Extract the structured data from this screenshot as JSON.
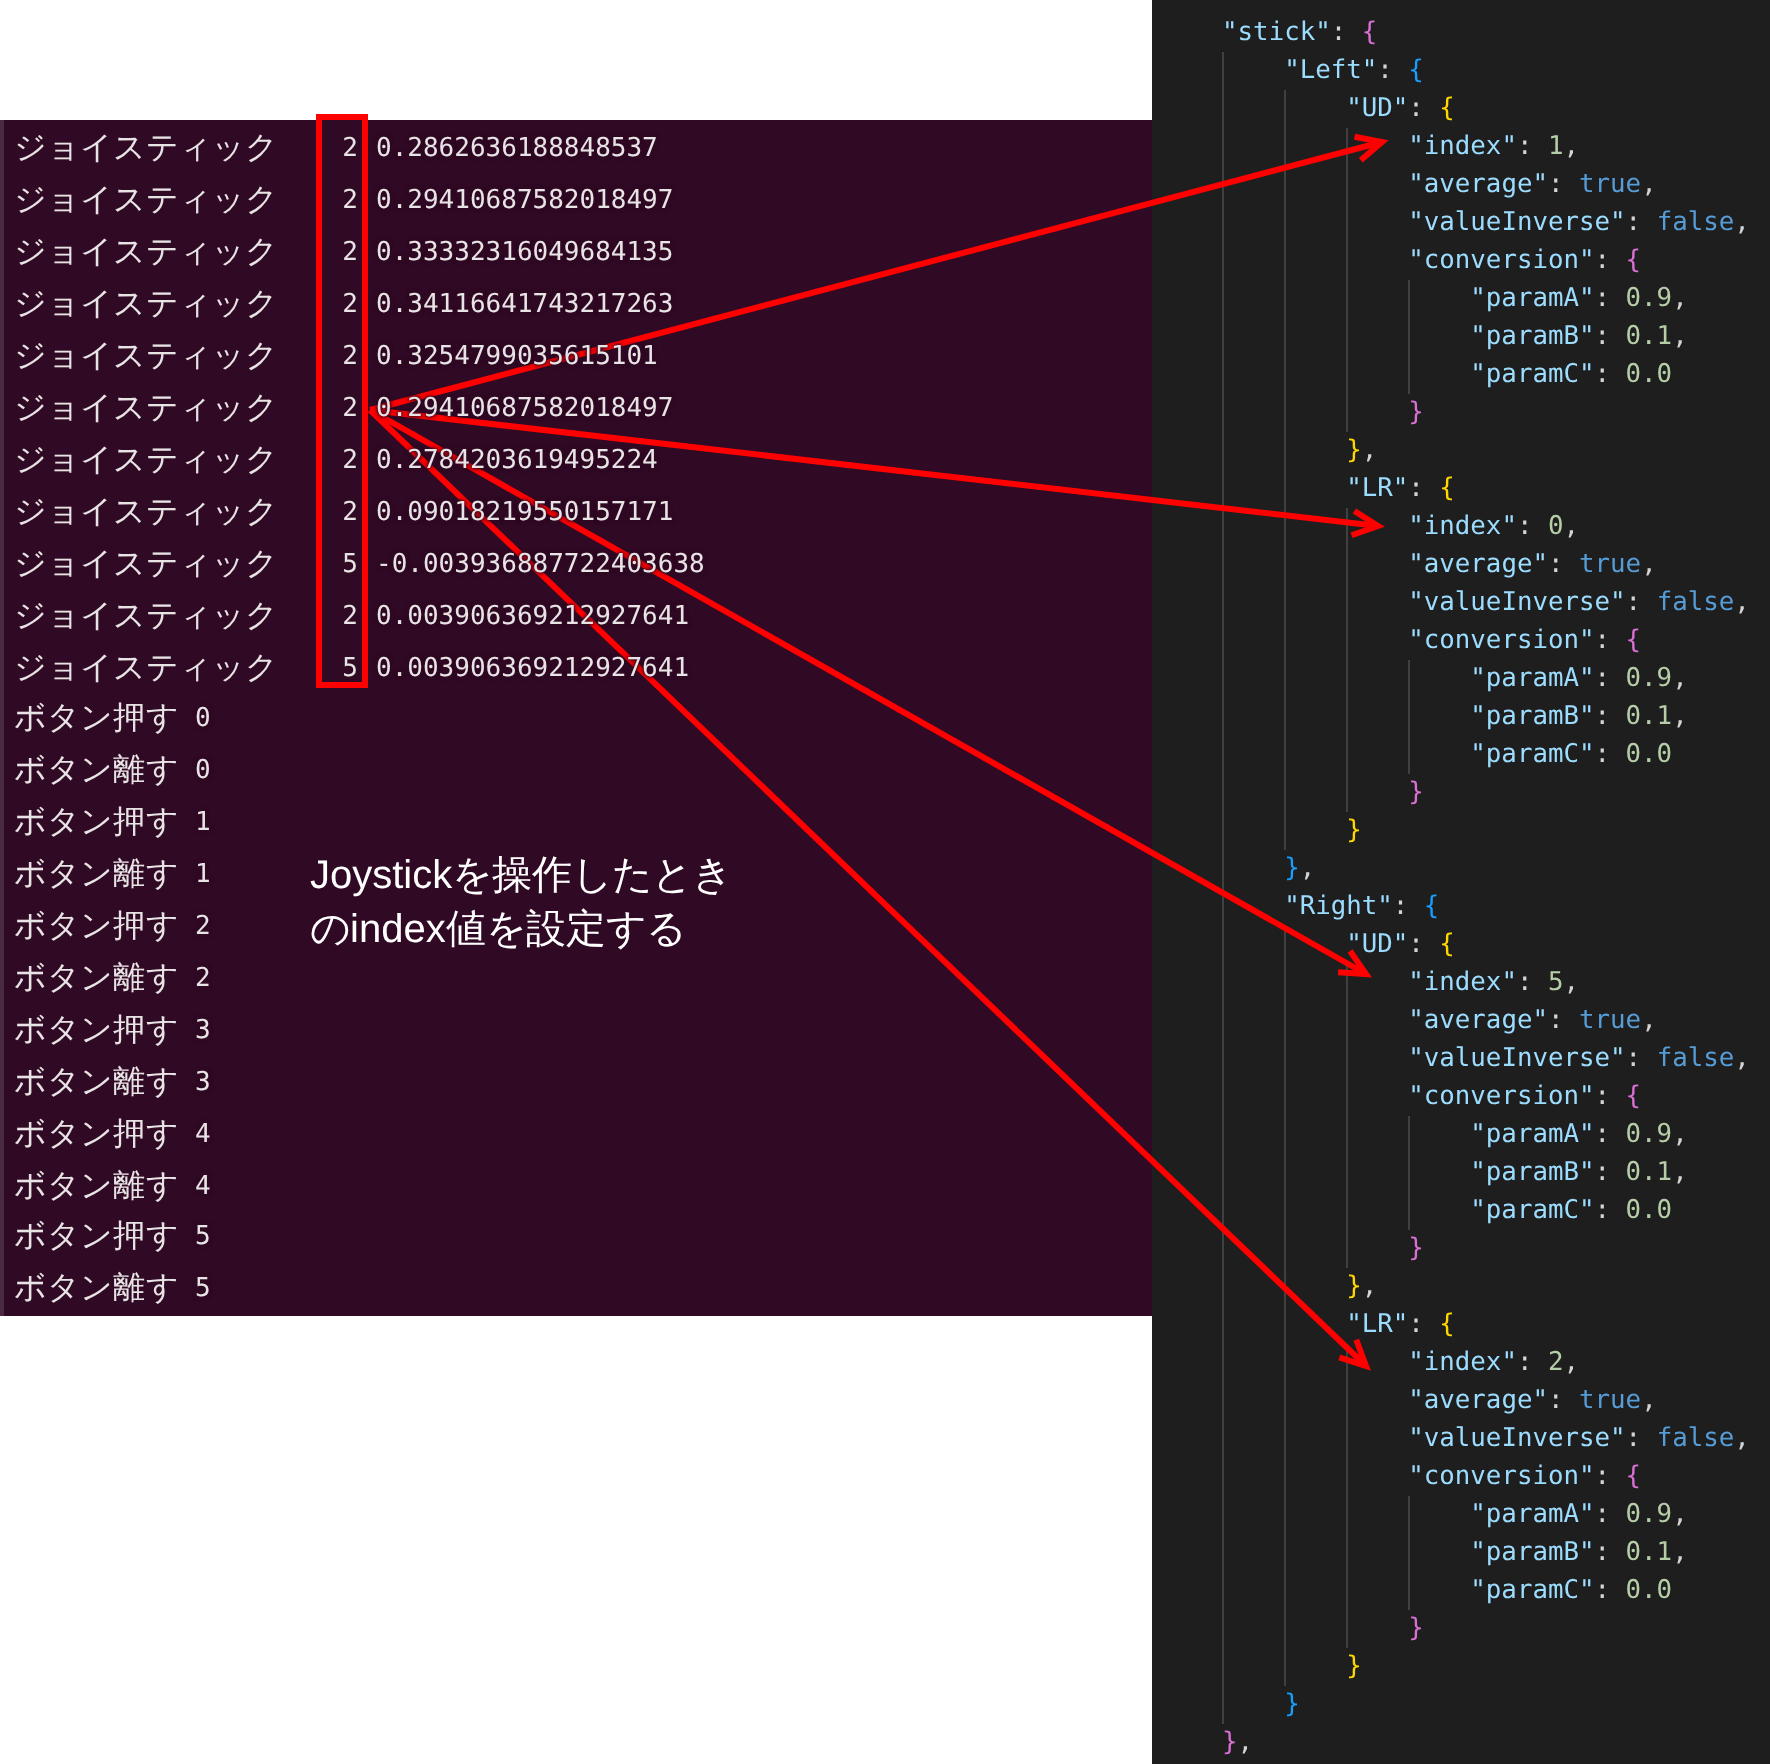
{
  "terminal": {
    "joystick_lines": [
      {
        "label": "ジョイスティック",
        "index": "2",
        "value": "0.2862636188848537"
      },
      {
        "label": "ジョイスティック",
        "index": "2",
        "value": "0.29410687582018497"
      },
      {
        "label": "ジョイスティック",
        "index": "2",
        "value": "0.33332316049684135"
      },
      {
        "label": "ジョイスティック",
        "index": "2",
        "value": "0.34116641743217263"
      },
      {
        "label": "ジョイスティック",
        "index": "2",
        "value": "0.3254799035615101"
      },
      {
        "label": "ジョイスティック",
        "index": "2",
        "value": "0.29410687582018497"
      },
      {
        "label": "ジョイスティック",
        "index": "2",
        "value": "0.2784203619495224"
      },
      {
        "label": "ジョイスティック",
        "index": "2",
        "value": "0.09018219550157171"
      },
      {
        "label": "ジョイスティック",
        "index": "5",
        "value": "-0.003936887722403638"
      },
      {
        "label": "ジョイスティック",
        "index": "2",
        "value": "0.003906369212927641"
      },
      {
        "label": "ジョイスティック",
        "index": "5",
        "value": "0.003906369212927641"
      }
    ],
    "button_lines": [
      {
        "label": "ボタン押す",
        "number": "0"
      },
      {
        "label": "ボタン離す",
        "number": "0"
      },
      {
        "label": "ボタン押す",
        "number": "1"
      },
      {
        "label": "ボタン離す",
        "number": "1"
      },
      {
        "label": "ボタン押す",
        "number": "2"
      },
      {
        "label": "ボタン離す",
        "number": "2"
      },
      {
        "label": "ボタン押す",
        "number": "3"
      },
      {
        "label": "ボタン離す",
        "number": "3"
      },
      {
        "label": "ボタン押す",
        "number": "4"
      },
      {
        "label": "ボタン離す",
        "number": "4"
      },
      {
        "label": "ボタン押す",
        "number": "5"
      },
      {
        "label": "ボタン離す",
        "number": "5"
      }
    ]
  },
  "annotation": {
    "lines": [
      "Joystickを操作したとき",
      "のindex値を設定する"
    ]
  },
  "editor": {
    "code_lines": [
      "    \"stick\": {",
      "        \"Left\": {",
      "            \"UD\": {",
      "                \"index\": 1,",
      "                \"average\": true,",
      "                \"valueInverse\": false,",
      "                \"conversion\": {",
      "                    \"paramA\": 0.9,",
      "                    \"paramB\": 0.1,",
      "                    \"paramC\": 0.0",
      "                }",
      "            },",
      "            \"LR\": {",
      "                \"index\": 0,",
      "                \"average\": true,",
      "                \"valueInverse\": false,",
      "                \"conversion\": {",
      "                    \"paramA\": 0.9,",
      "                    \"paramB\": 0.1,",
      "                    \"paramC\": 0.0",
      "                }",
      "            }",
      "        },",
      "        \"Right\": {",
      "            \"UD\": {",
      "                \"index\": 5,",
      "                \"average\": true,",
      "                \"valueInverse\": false,",
      "                \"conversion\": {",
      "                    \"paramA\": 0.9,",
      "                    \"paramB\": 0.1,",
      "                    \"paramC\": 0.0",
      "                }",
      "            },",
      "            \"LR\": {",
      "                \"index\": 2,",
      "                \"average\": true,",
      "                \"valueInverse\": false,",
      "                \"conversion\": {",
      "                    \"paramA\": 0.9,",
      "                    \"paramB\": 0.1,",
      "                    \"paramC\": 0.0",
      "                }",
      "            }",
      "        }",
      "    },"
    ]
  }
}
